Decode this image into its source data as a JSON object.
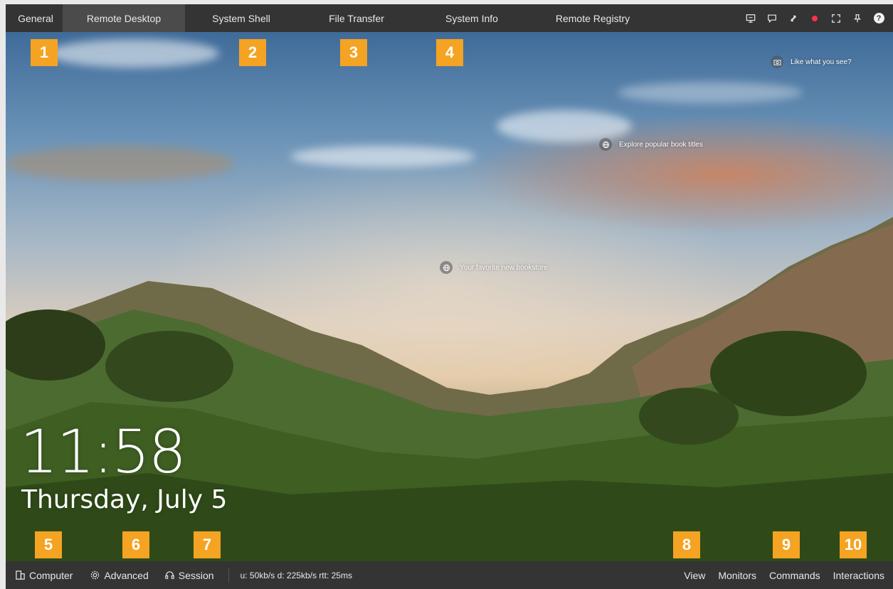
{
  "tabs": [
    {
      "label": "General",
      "active": false
    },
    {
      "label": "Remote Desktop",
      "active": true
    },
    {
      "label": "System Shell",
      "active": false
    },
    {
      "label": "File Transfer",
      "active": false
    },
    {
      "label": "System Info",
      "active": false
    },
    {
      "label": "Remote Registry",
      "active": false
    }
  ],
  "top_icons": [
    "monitor-icon",
    "chat-icon",
    "swap-arrows-icon",
    "record-icon",
    "fullscreen-icon",
    "pin-icon",
    "help-icon"
  ],
  "lockscreen": {
    "time": "11:58",
    "date": "Thursday, July 5",
    "hotspots": {
      "like": "Like what you see?",
      "explore": "Explore popular book titles",
      "bookstore": "Your favorite new bookstore"
    }
  },
  "badges": [
    "1",
    "2",
    "3",
    "4",
    "5",
    "6",
    "7",
    "8",
    "9",
    "10"
  ],
  "bottom": {
    "computer": "Computer",
    "advanced": "Advanced",
    "session": "Session",
    "stats": "u: 50kb/s d: 225kb/s rtt: 25ms",
    "view": "View",
    "monitors": "Monitors",
    "commands": "Commands",
    "interactions": "Interactions"
  },
  "colors": {
    "bar": "#343434",
    "active_tab": "#4b4b4b",
    "badge": "#f5a322",
    "record": "#ff2f4e"
  }
}
